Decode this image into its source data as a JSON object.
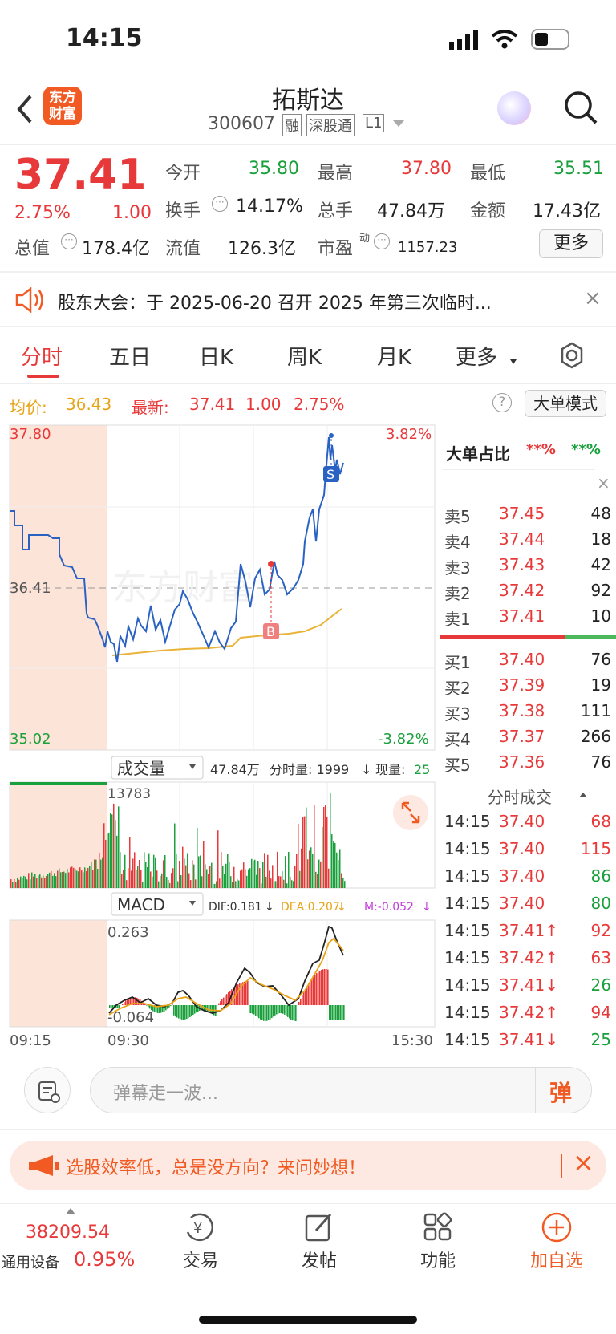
{
  "status_bar": {
    "time": "14:15"
  },
  "header": {
    "title": "拓斯达",
    "code": "300607",
    "tags": [
      "融",
      "深股通",
      "L1"
    ]
  },
  "quote": {
    "price": "37.41",
    "pct": "2.75%",
    "change": "1.00",
    "fields": [
      {
        "label": "今开",
        "value": "35.80",
        "color": "green"
      },
      {
        "label": "最高",
        "value": "37.80",
        "color": "red"
      },
      {
        "label": "最低",
        "value": "35.51",
        "color": "green"
      },
      {
        "label": "换手",
        "value": "14.17%"
      },
      {
        "label": "总手",
        "value": "47.84万"
      },
      {
        "label": "金额",
        "value": "17.43亿"
      },
      {
        "label": "总值",
        "value": "178.4亿"
      },
      {
        "label": "流值",
        "value": "126.3亿"
      },
      {
        "label": "市盈",
        "sup": "动",
        "value": "1157.23"
      }
    ],
    "more_button": "更多"
  },
  "notice": {
    "text": "股东大会：于 2025-06-20 召开 2025 年第三次临时..."
  },
  "tabs": [
    "分时",
    "五日",
    "日K",
    "周K",
    "月K",
    "更多"
  ],
  "chart_info": {
    "avg_label": "均价:",
    "avg_value": "36.43",
    "latest_label": "最新:",
    "latest_value": "37.41",
    "latest_change": "1.00",
    "latest_pct": "2.75%",
    "mode_button": "大单模式"
  },
  "chart_labels": {
    "high": "37.80",
    "low": "35.02",
    "mid": "36.41",
    "pct_high": "3.82%",
    "pct_low": "-3.82%",
    "marker_s": "S",
    "marker_b": "B",
    "watermark": "东方财富"
  },
  "volume_bar": {
    "selector": "成交量",
    "total": "47.84万",
    "fs_label": "分时量: 1999",
    "arrow": "↓",
    "now_label": "现量:",
    "now_value": "25",
    "max": "13783"
  },
  "macd_bar": {
    "selector": "MACD",
    "dif": "DIF:0.181",
    "dea": "DEA:0.207",
    "m": "M:-0.052",
    "arrow": "↓",
    "max": "0.263",
    "min": "-0.064"
  },
  "time_axis": [
    "09:15",
    "09:30",
    "15:30"
  ],
  "chart_data": [
    {
      "type": "line",
      "title": "",
      "series": [
        {
          "name": "",
          "role": "price",
          "x": [
            "09:15",
            "09:20",
            "09:25",
            "09:30",
            "09:45",
            "10:00",
            "10:30",
            "11:00",
            "11:30",
            "13:00",
            "13:30",
            "14:00",
            "14:10",
            "14:15"
          ],
          "values": [
            36.6,
            36.55,
            36.35,
            35.95,
            36.0,
            36.1,
            35.95,
            36.2,
            36.0,
            36.5,
            36.3,
            37.1,
            37.75,
            37.4
          ]
        },
        {
          "name": "",
          "role": "average",
          "x": [
            "09:30",
            "10:30",
            "11:30",
            "13:30",
            "14:00",
            "14:15"
          ],
          "values": [
            35.95,
            36.0,
            36.05,
            36.15,
            36.2,
            36.43
          ]
        }
      ],
      "ylim": [
        35.02,
        37.8
      ],
      "reference": 36.41
    },
    {
      "type": "bar",
      "title": "",
      "ylabel": "",
      "max": 13783
    },
    {
      "type": "bar",
      "title": "",
      "series": [
        {
          "name": "DIF",
          "value": 0.181
        },
        {
          "name": "DEA",
          "value": 0.207
        },
        {
          "name": "M",
          "value": -0.052
        }
      ],
      "ylim": [
        -0.064,
        0.263
      ]
    }
  ],
  "order_book": {
    "header": "大单占比",
    "header_v1": "**%",
    "header_v2": "**%",
    "sells": [
      {
        "label": "卖5",
        "price": "37.45",
        "vol": "48"
      },
      {
        "label": "卖4",
        "price": "37.44",
        "vol": "18"
      },
      {
        "label": "卖3",
        "price": "37.43",
        "vol": "42"
      },
      {
        "label": "卖2",
        "price": "37.42",
        "vol": "92"
      },
      {
        "label": "卖1",
        "price": "37.41",
        "vol": "10"
      }
    ],
    "buys": [
      {
        "label": "买1",
        "price": "37.40",
        "vol": "76"
      },
      {
        "label": "买2",
        "price": "37.39",
        "vol": "19"
      },
      {
        "label": "买3",
        "price": "37.38",
        "vol": "111"
      },
      {
        "label": "买4",
        "price": "37.37",
        "vol": "266"
      },
      {
        "label": "买5",
        "price": "37.36",
        "vol": "76"
      }
    ]
  },
  "trades": {
    "title": "分时成交",
    "rows": [
      {
        "t": "14:15",
        "p": "37.40",
        "v": "68",
        "pc": "red",
        "vc": "red"
      },
      {
        "t": "14:15",
        "p": "37.40",
        "v": "115",
        "pc": "red",
        "vc": "red"
      },
      {
        "t": "14:15",
        "p": "37.40",
        "v": "86",
        "pc": "red",
        "vc": "green"
      },
      {
        "t": "14:15",
        "p": "37.40",
        "v": "80",
        "pc": "red",
        "vc": "green"
      },
      {
        "t": "14:15",
        "p": "37.41↑",
        "v": "92",
        "pc": "red",
        "vc": "red"
      },
      {
        "t": "14:15",
        "p": "37.42↑",
        "v": "63",
        "pc": "red",
        "vc": "red"
      },
      {
        "t": "14:15",
        "p": "37.41↓",
        "v": "26",
        "pc": "red",
        "vc": "green"
      },
      {
        "t": "14:15",
        "p": "37.42↑",
        "v": "94",
        "pc": "red",
        "vc": "red"
      },
      {
        "t": "14:15",
        "p": "37.41↓",
        "v": "25",
        "pc": "red",
        "vc": "green"
      }
    ]
  },
  "comment": {
    "placeholder": "弹幕走一波...",
    "button": "弹"
  },
  "ad": {
    "text": "选股效率低，总是没方向？来问妙想！"
  },
  "bottom_nav": {
    "index_value": "38209.54",
    "index_name": "通用设备",
    "index_pct": "0.95%",
    "items": [
      "交易",
      "发帖",
      "功能",
      "加自选"
    ]
  }
}
